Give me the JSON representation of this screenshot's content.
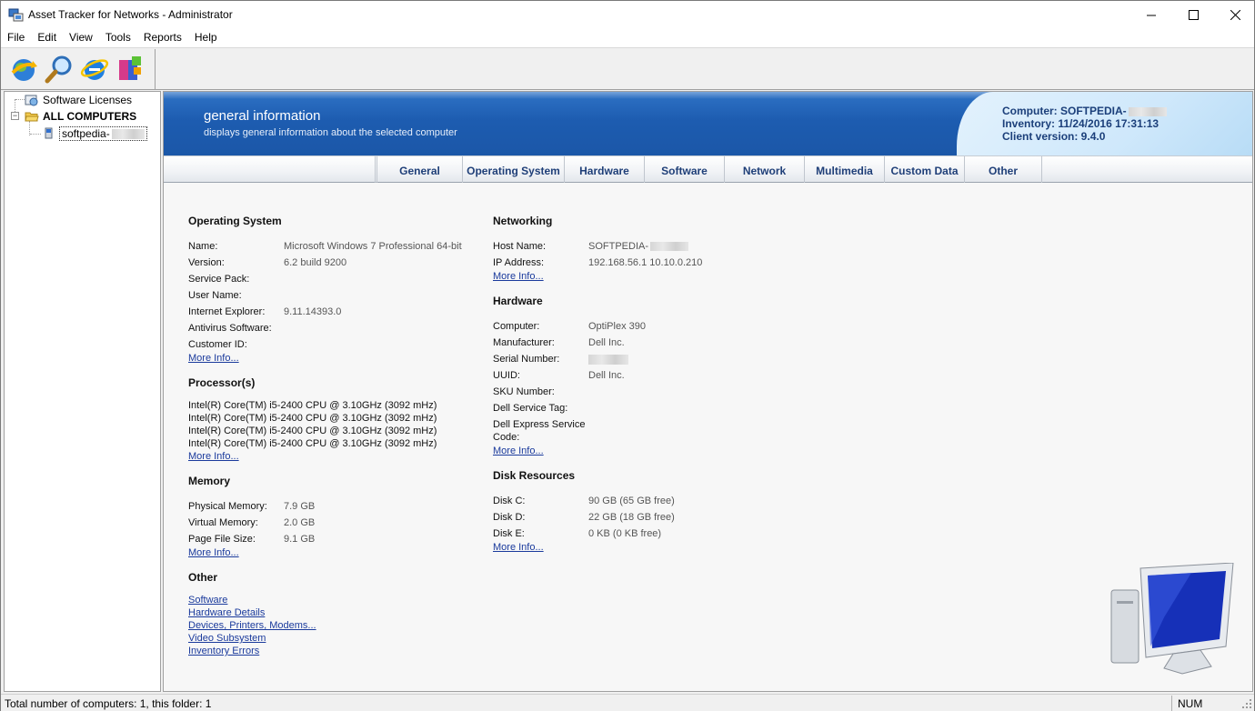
{
  "window": {
    "title": "Asset Tracker for Networks - Administrator"
  },
  "menu": [
    "File",
    "Edit",
    "View",
    "Tools",
    "Reports",
    "Help"
  ],
  "toolbar": {
    "buttons": [
      "refresh-icon",
      "search-icon",
      "internet-explorer-icon",
      "install-package-icon"
    ]
  },
  "tree": {
    "software_licenses": "Software Licenses",
    "all_computers": "ALL COMPUTERS",
    "computer": "softpedia-"
  },
  "banner": {
    "title": "general information",
    "subtitle": "displays general information about the selected computer",
    "computer": "Computer: SOFTPEDIA-",
    "inventory": "Inventory: 11/24/2016 17:31:13",
    "client_version": "Client version: 9.4.0"
  },
  "tabs": [
    "General",
    "Operating System",
    "Hardware",
    "Software",
    "Network",
    "Multimedia",
    "Custom Data",
    "Other"
  ],
  "os": {
    "title": "Operating System",
    "rows": [
      {
        "label": "Name:",
        "value": "Microsoft Windows 7 Professional 64-bit"
      },
      {
        "label": "Version:",
        "value": "6.2 build 9200"
      },
      {
        "label": "Service Pack:",
        "value": ""
      },
      {
        "label": "User Name:",
        "value": ""
      },
      {
        "label": "Internet Explorer:",
        "value": "9.11.14393.0"
      },
      {
        "label": "Antivirus Software:",
        "value": ""
      },
      {
        "label": "Customer ID:",
        "value": ""
      }
    ],
    "more": "More Info..."
  },
  "processor": {
    "title": "Processor(s)",
    "lines": [
      "Intel(R) Core(TM) i5-2400 CPU @ 3.10GHz (3092 mHz)",
      "Intel(R) Core(TM) i5-2400 CPU @ 3.10GHz (3092 mHz)",
      "Intel(R) Core(TM) i5-2400 CPU @ 3.10GHz (3092 mHz)",
      "Intel(R) Core(TM) i5-2400 CPU @ 3.10GHz (3092 mHz)"
    ],
    "more": "More Info..."
  },
  "memory": {
    "title": "Memory",
    "rows": [
      {
        "label": "Physical Memory:",
        "value": "7.9 GB"
      },
      {
        "label": "Virtual Memory:",
        "value": "2.0 GB"
      },
      {
        "label": "Page File Size:",
        "value": "9.1 GB"
      }
    ],
    "more": "More Info..."
  },
  "other": {
    "title": "Other",
    "links": [
      "Software",
      "Hardware Details",
      "Devices, Printers, Modems...",
      "Video Subsystem",
      "Inventory Errors"
    ]
  },
  "networking": {
    "title": "Networking",
    "rows": [
      {
        "label": "Host Name:",
        "value": "SOFTPEDIA-"
      },
      {
        "label": "IP Address:",
        "value": "192.168.56.1 10.10.0.210"
      }
    ],
    "more": "More Info..."
  },
  "hardware": {
    "title": "Hardware",
    "rows": [
      {
        "label": "Computer:",
        "value": "OptiPlex 390"
      },
      {
        "label": "Manufacturer:",
        "value": "Dell Inc."
      },
      {
        "label": "Serial Number:",
        "value": ""
      },
      {
        "label": "UUID:",
        "value": "Dell Inc."
      },
      {
        "label": "SKU Number:",
        "value": ""
      },
      {
        "label": "Dell Service Tag:",
        "value": ""
      },
      {
        "label": "Dell Express Service",
        "value": ""
      },
      {
        "label": "Code:",
        "value": ""
      }
    ],
    "more": "More Info..."
  },
  "disk": {
    "title": "Disk Resources",
    "rows": [
      {
        "label": "Disk C:",
        "value": "90 GB (65 GB free)"
      },
      {
        "label": "Disk D:",
        "value": "22 GB (18 GB free)"
      },
      {
        "label": "Disk E:",
        "value": "0 KB (0 KB free)"
      }
    ],
    "more": "More Info..."
  },
  "status": {
    "text": "Total number of computers: 1, this folder: 1",
    "num": "NUM"
  }
}
